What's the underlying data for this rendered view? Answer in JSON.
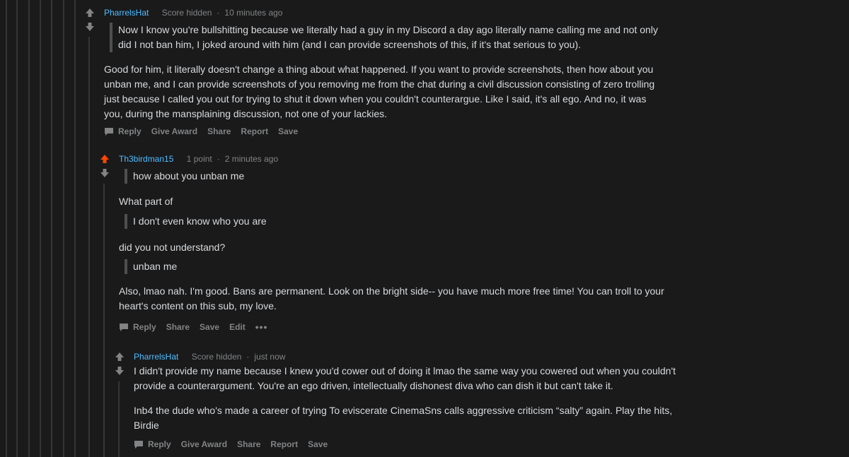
{
  "colors": {
    "background": "#1a1a1b",
    "text": "#d7dadc",
    "meta": "#818384",
    "author": "#4fbcff",
    "upvote_active": "#ff4500",
    "thread_line": "#343536"
  },
  "comments": [
    {
      "author": "PharrelsHat",
      "score": "Score hidden",
      "time": "10 minutes ago",
      "upvoted": false,
      "quote": "Now I know you're bullshitting because we literally had a guy in my Discord a day ago literally name calling me and not only did I not ban him, I joked around with him (and I can provide screenshots of this, if it's that serious to you).",
      "paragraph": "Good for him, it literally doesn't change a thing about what happened. If you want to provide screenshots, then how about you unban me, and I can provide screenshots of you removing me from the chat during a civil discussion consisting of zero trolling just because I called you out for trying to shut it down when you couldn't counterargue. Like I said, it's all ego. And no, it was you, during the mansplaining discussion, not one of your lackies.",
      "actions": [
        "Reply",
        "Give Award",
        "Share",
        "Report",
        "Save"
      ]
    },
    {
      "author": "Th3birdman15",
      "score": "1 point",
      "time": "2 minutes ago",
      "upvoted": true,
      "quote1": "how about you unban me",
      "text1": "What part of",
      "quote2": "I don't even know who you are",
      "text2": "did you not understand?",
      "quote3": "unban me",
      "paragraph": "Also, lmao nah. I'm good. Bans are permanent. Look on the bright side-- you have much more free time! You can troll to your heart's content on this sub, my love.",
      "actions": [
        "Reply",
        "Share",
        "Save",
        "Edit"
      ],
      "more_label": "•••"
    },
    {
      "author": "PharrelsHat",
      "score": "Score hidden",
      "time": "just now",
      "upvoted": false,
      "paragraph1": "I didn't provide my name because I knew you'd cower out of doing it lmao the same way you cowered out when you couldn't provide a counterargument. You're an ego driven, intellectually dishonest diva who can dish it but can't take it.",
      "paragraph2": "Inb4 the dude who's made a career of trying To eviscerate CinemaSns calls aggressive criticism “salty” again. Play the hits, Birdie",
      "actions": [
        "Reply",
        "Give Award",
        "Share",
        "Report",
        "Save"
      ]
    }
  ]
}
